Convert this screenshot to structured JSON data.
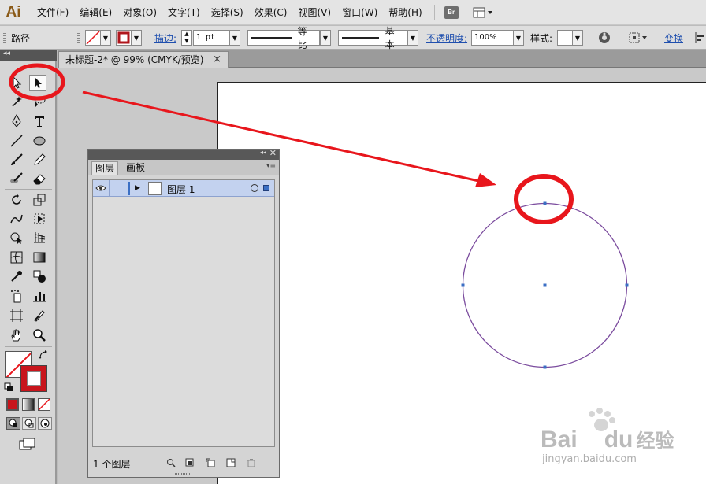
{
  "app": {
    "logo": "Ai"
  },
  "menu": {
    "items": [
      "文件(F)",
      "编辑(E)",
      "对象(O)",
      "文字(T)",
      "选择(S)",
      "效果(C)",
      "视图(V)",
      "窗口(W)",
      "帮助(H)"
    ],
    "bridge_label": "Br"
  },
  "control_bar": {
    "selection_label": "路径",
    "stroke_label": "描边:",
    "stroke_weight": "1 pt",
    "stroke_profile": "等比",
    "brush": "基本",
    "opacity_label": "不透明度:",
    "opacity_value": "100%",
    "style_label": "样式:",
    "transform_label": "变换"
  },
  "document": {
    "tab_title": "未标题-2* @ 99% (CMYK/预览)",
    "tab_close": "×"
  },
  "layers_panel": {
    "tabs": [
      "图层",
      "画板"
    ],
    "layer_name": "图层 1",
    "footer_count": "1 个图层"
  },
  "watermark": {
    "brand": "Bai",
    "brand2": "du",
    "cn": "经验",
    "url": "jingyan.baidu.com"
  },
  "colors": {
    "annotation_red": "#e8161c",
    "path_purple": "#7b4c9e",
    "anchor_blue": "#3b6fc4",
    "selection_bg": "#c3d2ef",
    "link_blue": "#1f4fae"
  },
  "icons": [
    "selection-tool",
    "direct-selection-tool",
    "magic-wand",
    "lasso",
    "pen",
    "type",
    "line",
    "ellipse",
    "paintbrush",
    "pencil",
    "blob-brush",
    "eraser",
    "rotate",
    "scale",
    "warp",
    "free-transform",
    "shape-builder",
    "perspective-grid",
    "mesh",
    "gradient",
    "eyedropper",
    "blend",
    "symbol-sprayer",
    "column-graph",
    "artboard",
    "slice",
    "hand",
    "zoom"
  ]
}
